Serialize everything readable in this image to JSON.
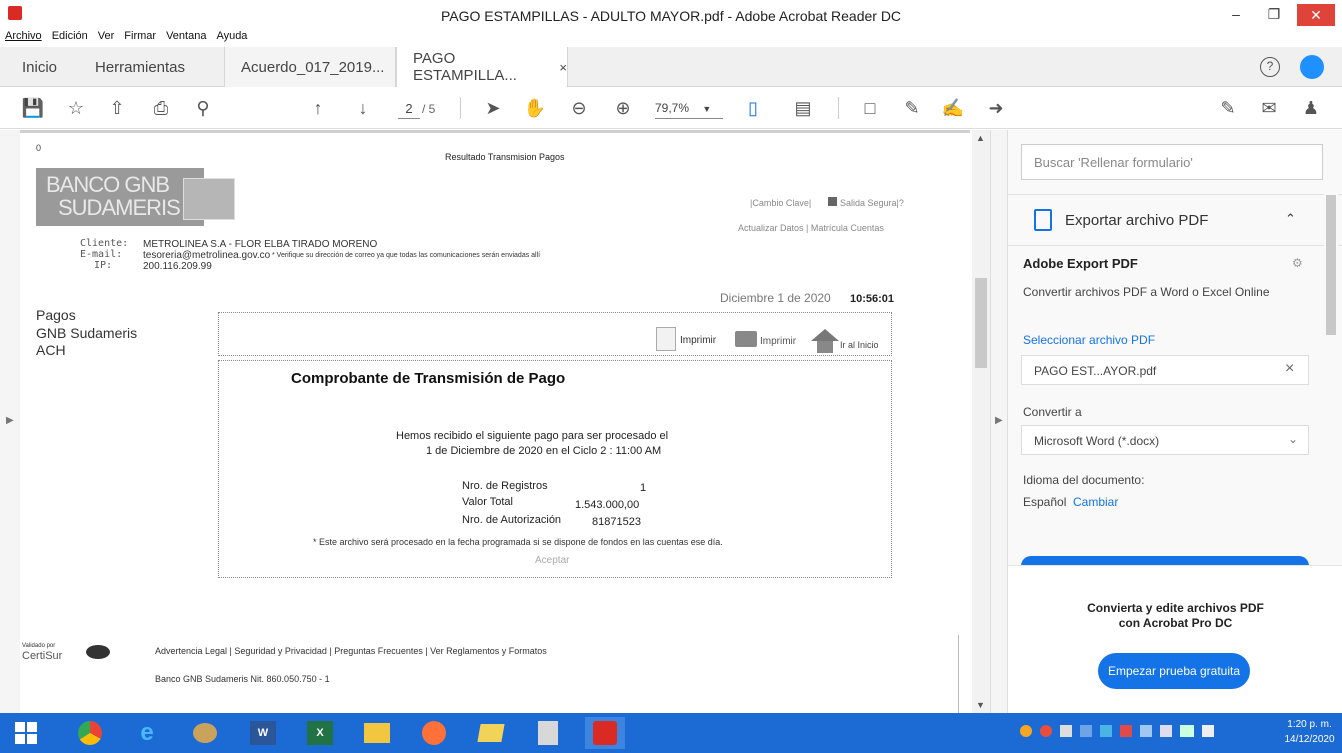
{
  "window": {
    "title": "PAGO ESTAMPILLAS - ADULTO MAYOR.pdf - Adobe Acrobat Reader DC",
    "menu": [
      "Archivo",
      "Edición",
      "Ver",
      "Firmar",
      "Ventana",
      "Ayuda"
    ]
  },
  "tabs": {
    "home": "Inicio",
    "tools": "Herramientas",
    "file1": "Acuerdo_017_2019...",
    "file2": "PAGO ESTAMPILLA...",
    "close": "×"
  },
  "toolbar": {
    "page_current": "2",
    "page_total": "/ 5",
    "zoom": "79,7%"
  },
  "document": {
    "corner_zero": "0",
    "header_title": "Resultado Transmision Pagos",
    "bank_name_1": "BANCO GNB",
    "bank_name_2": "SUDAMERIS",
    "link_change_key": "|Cambio Clave|",
    "link_exit": "Salida Segura|?",
    "link_update": "Actualizar Datos | Matrícula Cuentas",
    "client_label": "Cliente:",
    "client_value": "METROLINEA S.A - FLOR ELBA TIRADO MORENO",
    "email_label": "E-mail:",
    "email_value": "tesoreria@metrolinea.gov.co",
    "email_note": "* Verifique su dirección de correo ya que todas las comunicaciones serán enviadas allí",
    "ip_label": "IP:",
    "ip_value": "200.116.209.99",
    "date_text": "Diciembre 1 de 2020",
    "time_text": "10:56:01",
    "side_nav": [
      "Pagos",
      "GNB Sudameris",
      "ACH"
    ],
    "print_label_1": "Imprimir",
    "print_label_2": "Imprimir",
    "home_label": "Ir al Inicio",
    "receipt_title": "Comprobante de Transmisión de Pago",
    "receipt_line1": "Hemos recibido el siguiente pago para ser procesado el",
    "receipt_line2": "1 de Diciembre de 2020 en el  Ciclo 2 : 11:00 AM",
    "rows": [
      {
        "label": "Nro. de Registros",
        "value": "1"
      },
      {
        "label": "Valor Total",
        "value": "1.543.000,00"
      },
      {
        "label": "Nro. de Autorización",
        "value": "81871523"
      }
    ],
    "receipt_note": "* Este archivo será procesado en la fecha programada si se dispone de fondos en las cuentas ese día.",
    "accept": "Aceptar",
    "validated_by": "Validado por",
    "certisur": "CertiSur",
    "footer_links": "Advertencia Legal | Seguridad y Privacidad | Preguntas Frecuentes | Ver Reglamentos y Formatos",
    "footer_nit": "Banco GNB Sudameris Nit. 860.050.750 - 1"
  },
  "panel": {
    "search_placeholder": "Buscar 'Rellenar formulario'",
    "export_title": "Exportar archivo PDF",
    "adobe_export": "Adobe Export PDF",
    "convert_desc": "Convertir archivos PDF a Word o Excel Online",
    "select_file": "Seleccionar archivo PDF",
    "file_name": "PAGO EST...AYOR.pdf",
    "convert_to": "Convertir a",
    "format": "Microsoft Word (*.docx)",
    "doc_lang": "Idioma del documento:",
    "lang": "Español",
    "change": "Cambiar",
    "promo_1": "Convierta y edite archivos PDF",
    "promo_2": "con Acrobat Pro DC",
    "trial_button": "Empezar prueba gratuita"
  },
  "taskbar": {
    "time": "1:20 p. m.",
    "date": "14/12/2020"
  },
  "colors": {
    "accent_blue": "#1473e6",
    "taskbar": "#1c6ad4",
    "acrobat_red": "#d92b24"
  }
}
